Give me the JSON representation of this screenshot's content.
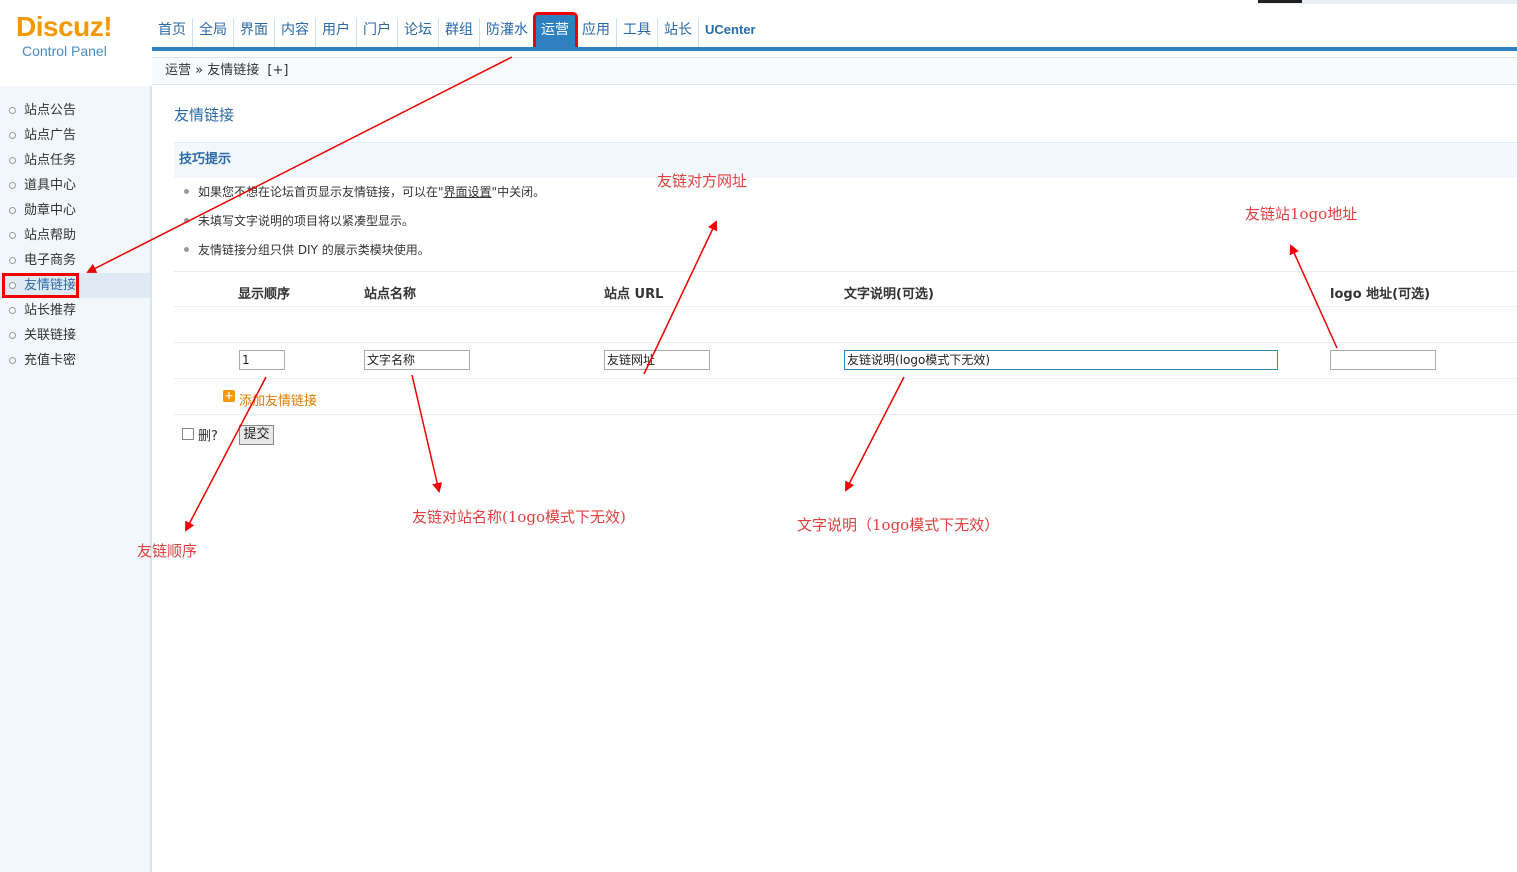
{
  "logo": {
    "main": "Discuz",
    "bang": "!",
    "sub": "Control Panel"
  },
  "topnav": {
    "items": [
      "首页",
      "全局",
      "界面",
      "内容",
      "用户",
      "门户",
      "论坛",
      "群组",
      "防灌水",
      "运营",
      "应用",
      "工具",
      "站长",
      "UCenter"
    ],
    "active": "运营"
  },
  "breadcrumb": {
    "parent": "运营",
    "sep": "»",
    "current": "友情链接",
    "plus": "[+]"
  },
  "sidebar": {
    "items": [
      "站点公告",
      "站点广告",
      "站点任务",
      "道具中心",
      "勋章中心",
      "站点帮助",
      "电子商务",
      "友情链接",
      "站长推荐",
      "关联链接",
      "充值卡密"
    ],
    "active": "友情链接"
  },
  "main": {
    "title": "友情链接",
    "tips_title": "技巧提示",
    "tips": {
      "t1_pre": "如果您不想在论坛首页显示友情链接，可以在\"",
      "t1_link": "界面设置",
      "t1_post": "\"中关闭。",
      "t2": "未填写文字说明的项目将以紧凑型显示。",
      "t3": "友情链接分组只供 DIY 的展示类模块使用。"
    },
    "columns": [
      "显示顺序",
      "站点名称",
      "站点 URL",
      "文字说明(可选)",
      "logo 地址(可选)"
    ],
    "row": {
      "order": "1",
      "name": "文字名称",
      "url": "友链网址",
      "desc": "友链说明(logo模式下无效)",
      "logo": ""
    },
    "add_link": "添加友情链接",
    "delete_label": "删?",
    "submit": "提交"
  },
  "annotations": {
    "url": "友链对方网址",
    "logo": "友链站1ogo地址",
    "name": "友链对站名称(1ogo模式下无效)",
    "desc": "文字说明（1ogo模式下无效）",
    "order": "友链顺序"
  }
}
